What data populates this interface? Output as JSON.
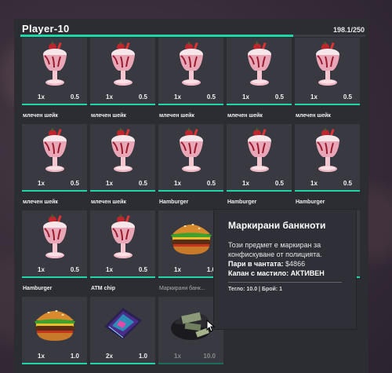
{
  "inventory": {
    "title": "Player-10",
    "weight": "198.1/250",
    "weight_fraction": 0.79
  },
  "slots": [
    {
      "label": "",
      "count": "1x",
      "weight": "0.5",
      "icon": "milkshake-icon"
    },
    {
      "label": "",
      "count": "1x",
      "weight": "0.5",
      "icon": "milkshake-icon"
    },
    {
      "label": "",
      "count": "1x",
      "weight": "0.5",
      "icon": "milkshake-icon"
    },
    {
      "label": "",
      "count": "1x",
      "weight": "0.5",
      "icon": "milkshake-icon"
    },
    {
      "label": "",
      "count": "1x",
      "weight": "0.5",
      "icon": "milkshake-icon"
    },
    {
      "label": "млечен шейк",
      "count": "1x",
      "weight": "0.5",
      "icon": "milkshake-icon"
    },
    {
      "label": "млечен шейк",
      "count": "1x",
      "weight": "0.5",
      "icon": "milkshake-icon"
    },
    {
      "label": "млечен шейк",
      "count": "1x",
      "weight": "0.5",
      "icon": "milkshake-icon"
    },
    {
      "label": "млечен шейк",
      "count": "1x",
      "weight": "0.5",
      "icon": "milkshake-icon"
    },
    {
      "label": "млечен шейк",
      "count": "1x",
      "weight": "0.5",
      "icon": "milkshake-icon"
    },
    {
      "label": "млечен шейк",
      "count": "1x",
      "weight": "0.5",
      "icon": "milkshake-icon"
    },
    {
      "label": "млечен шейк",
      "count": "1x",
      "weight": "0.5",
      "icon": "milkshake-icon"
    },
    {
      "label": "Hamburger",
      "count": "1x",
      "weight": "1.0",
      "icon": "burger-icon"
    },
    {
      "label": "Hamburger",
      "count": "",
      "weight": "",
      "icon": ""
    },
    {
      "label": "Hamburger",
      "count": "",
      "weight": "",
      "icon": ""
    },
    {
      "label": "Hamburger",
      "count": "1x",
      "weight": "1.0",
      "icon": "burger-icon"
    },
    {
      "label": "ATM chip",
      "count": "2x",
      "weight": "1.0",
      "icon": "chip-icon"
    },
    {
      "label": "Маркирани банк...",
      "count": "1x",
      "weight": "10.0",
      "icon": "banknotes-icon"
    }
  ],
  "tooltip": {
    "title": "Маркирани банкноти",
    "description": "Този предмет е маркиран за конфискуване от полицията.",
    "cash_label": "Пари в чантата:",
    "cash_value": "$4866",
    "trap_label": "Капан с мастило:",
    "trap_value": "АКТИВЕН",
    "footer": "Тегло: 10.0 | Брой: 1"
  },
  "colors": {
    "accent": "#1ed6a7",
    "panel": "#2c2d33",
    "slot": "#393a41"
  }
}
